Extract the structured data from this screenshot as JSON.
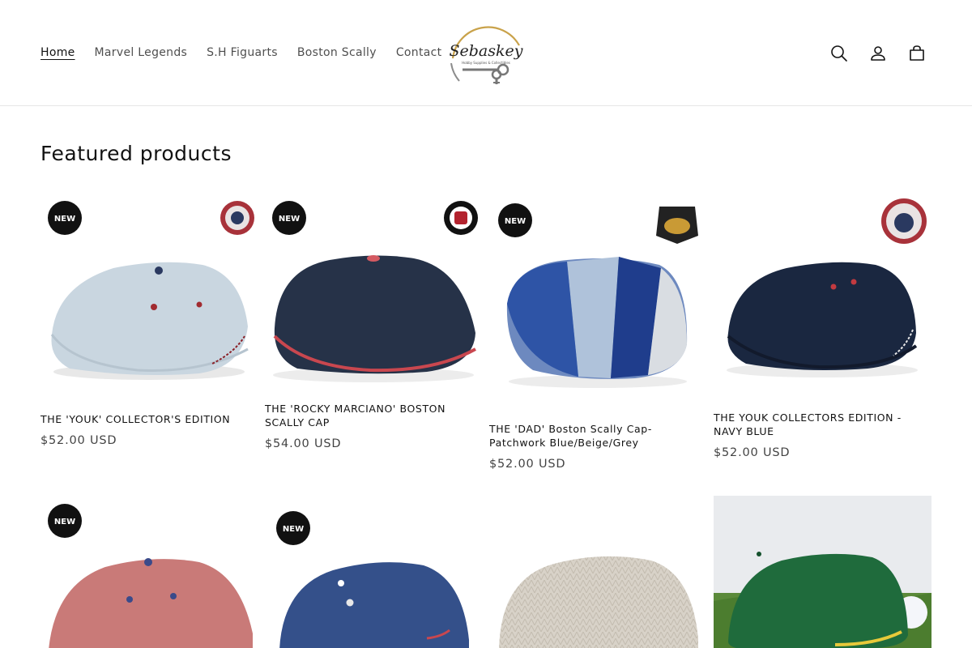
{
  "nav": {
    "items": [
      {
        "label": "Home",
        "active": true
      },
      {
        "label": "Marvel Legends",
        "active": false
      },
      {
        "label": "S.H Figuarts",
        "active": false
      },
      {
        "label": "Boston Scally",
        "active": false
      },
      {
        "label": "Contact",
        "active": false
      }
    ]
  },
  "logo": {
    "text": "Sebaskey",
    "subtext": "Hobby Supplies & Collectibles"
  },
  "header_icons": [
    "search-icon",
    "account-icon",
    "cart-icon"
  ],
  "section": {
    "title": "Featured products"
  },
  "products": [
    {
      "title": "THE 'YOUK' COLLECTOR'S EDITION",
      "price": "$52.00 USD",
      "badge": "NEW",
      "cap_color": "#c9d6e0"
    },
    {
      "title": "THE 'ROCKY MARCIANO' BOSTON SCALLY CAP",
      "price": "$54.00 USD",
      "badge": "NEW",
      "cap_color": "#263248"
    },
    {
      "title": "THE 'DAD' Boston Scally Cap-Patchwork Blue/Beige/Grey",
      "price": "$52.00 USD",
      "badge": "NEW",
      "cap_color": "#3b5fa3"
    },
    {
      "title": "THE YOUK COLLECTORS EDITION - NAVY BLUE",
      "price": "$52.00 USD",
      "badge": "",
      "cap_color": "#1a2740"
    }
  ],
  "products_row2": [
    {
      "badge": "NEW",
      "cap_color": "#c97a78"
    },
    {
      "badge": "NEW",
      "cap_color": "#34508a"
    },
    {
      "badge": "",
      "cap_color": "#d8d2c8"
    },
    {
      "badge": "",
      "cap_color": "#1f6b3c"
    }
  ],
  "colors": {
    "text": "#121212",
    "border": "#e6e6e6",
    "badge_bg": "#111111",
    "logo_gold": "#c9a24a"
  }
}
